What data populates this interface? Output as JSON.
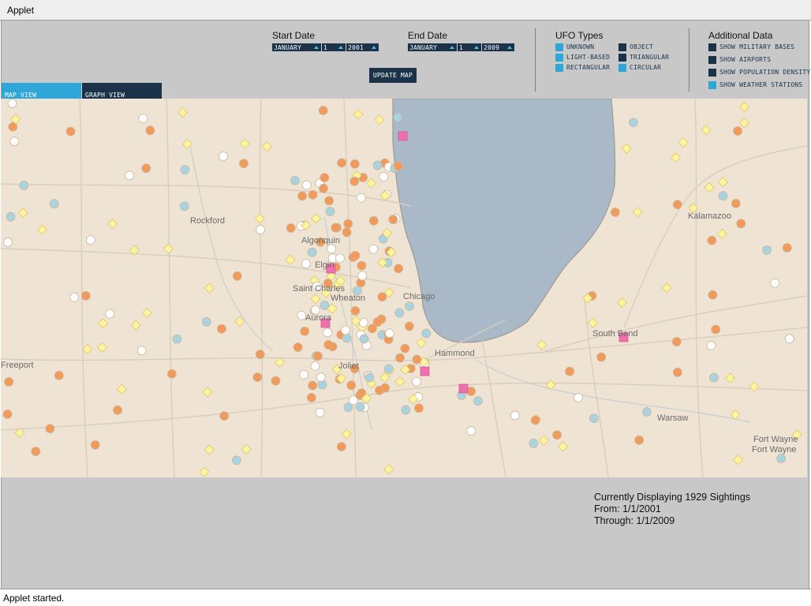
{
  "window": {
    "title": "Applet"
  },
  "start_date": {
    "label": "Start Date",
    "month": "JANUARY",
    "day": "1",
    "year": "2001"
  },
  "end_date": {
    "label": "End Date",
    "month": "JANUARY",
    "day": "1",
    "year": "2009"
  },
  "update_button": "UPDATE MAP",
  "ufo_types": {
    "label": "UFO Types",
    "items": [
      {
        "label": "UNKNOWN",
        "checked": true
      },
      {
        "label": "LIGHT-BASED",
        "checked": true
      },
      {
        "label": "RECTANGULAR",
        "checked": true
      },
      {
        "label": "OBJECT",
        "checked": false
      },
      {
        "label": "TRIANGULAR",
        "checked": false
      },
      {
        "label": "CIRCULAR",
        "checked": true
      }
    ]
  },
  "additional_data": {
    "label": "Additional Data",
    "items": [
      {
        "label": "SHOW MILITARY BASES",
        "checked": false
      },
      {
        "label": "SHOW AIRPORTS",
        "checked": false
      },
      {
        "label": "SHOW POPULATION DENSITY",
        "checked": false
      },
      {
        "label": "SHOW WEATHER STATIONS",
        "checked": true
      }
    ]
  },
  "tabs": [
    {
      "label": "MAP VIEW",
      "active": true
    },
    {
      "label": "GRAPH VIEW",
      "active": false
    }
  ],
  "map": {
    "cities": [
      "Rockford",
      "Algonquin",
      "Elgin",
      "Saint Charles",
      "Wheaton",
      "Chicago",
      "Aurora",
      "Joliet",
      "Hammond",
      "South Bend",
      "Kalamazoo",
      "Warsaw",
      "Fort Wayne",
      "Freeport"
    ],
    "colors": {
      "land": "#efe3d3",
      "water": "#aab9c8",
      "orange_marker": "#f29a59",
      "white_marker": "#ffffff",
      "blue_marker": "#a9d4df",
      "yellow_marker": "#fff2a0",
      "pink_marker": "#f06fae"
    }
  },
  "status": {
    "line1": "Currently Displaying 1929 Sightings",
    "line2": "From: 1/1/2001",
    "line3": "Through: 1/1/2009"
  },
  "footer": "Applet started."
}
